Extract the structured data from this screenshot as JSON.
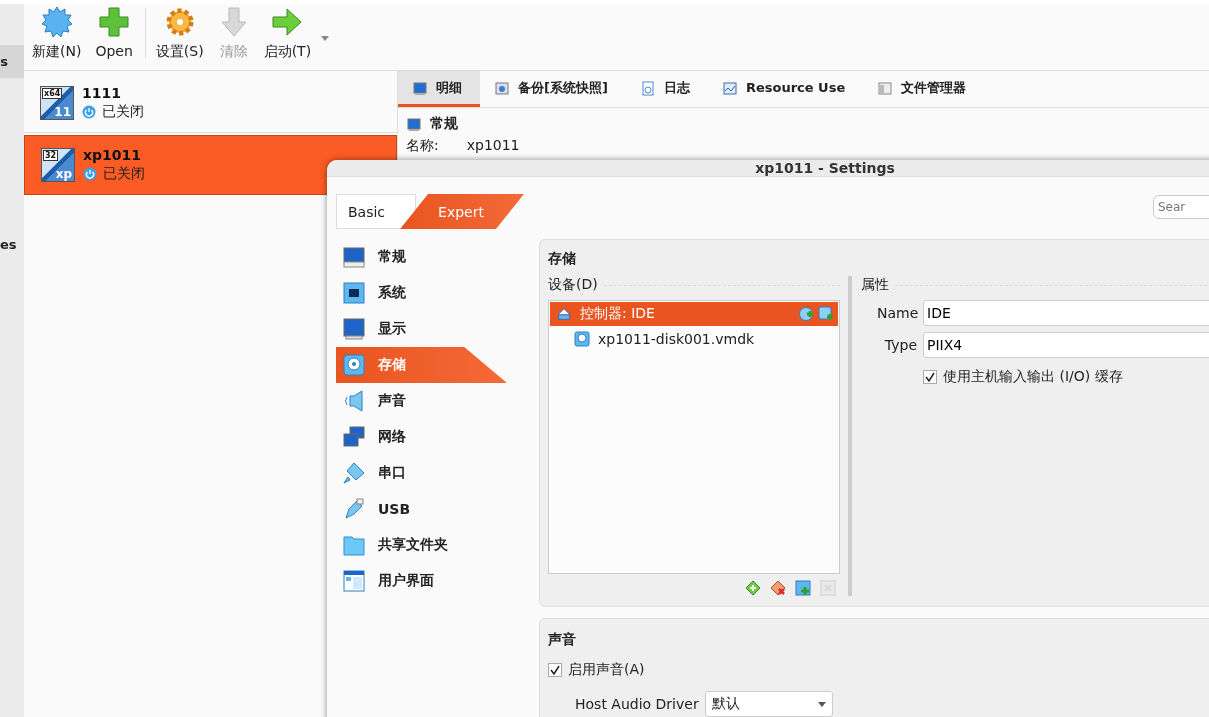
{
  "side_strip": [
    {
      "label": "s",
      "selected": true
    },
    {
      "label": "es",
      "selected": false
    }
  ],
  "toolbar": [
    {
      "label": "新建(N)",
      "kind": "new",
      "disabled": false
    },
    {
      "label": "Open",
      "kind": "add",
      "disabled": false
    },
    {
      "label": "设置(S)",
      "kind": "gear",
      "disabled": false
    },
    {
      "label": "清除",
      "kind": "down",
      "disabled": true
    },
    {
      "label": "启动(T)",
      "kind": "start",
      "disabled": false
    }
  ],
  "vms": [
    {
      "name": "1111",
      "state": "已关闭",
      "os_badge": "x64",
      "os_label": "11",
      "selected": false
    },
    {
      "name": "xp1011",
      "state": "已关闭",
      "os_badge": "32",
      "os_label": "xp",
      "selected": true
    }
  ],
  "details": {
    "tabs": [
      {
        "label": "明细",
        "kind": "details",
        "selected": true
      },
      {
        "label": "备份[系统快照]",
        "kind": "snapshot",
        "selected": false
      },
      {
        "label": "日志",
        "kind": "log",
        "selected": false
      },
      {
        "label": "Resource Use",
        "kind": "resource",
        "selected": false
      },
      {
        "label": "文件管理器",
        "kind": "files",
        "selected": false
      }
    ],
    "section": "常规",
    "rows": [
      {
        "label": "名称:",
        "value": "xp1011"
      }
    ]
  },
  "dialog": {
    "title": "xp1011 - Settings",
    "modes": [
      {
        "label": "Basic",
        "selected": false
      },
      {
        "label": "Expert",
        "selected": true
      }
    ],
    "search": {
      "placeholder": "Sear"
    },
    "nav": [
      {
        "label": "常规",
        "kind": "general",
        "selected": false
      },
      {
        "label": "系统",
        "kind": "system",
        "selected": false
      },
      {
        "label": "显示",
        "kind": "display",
        "selected": false
      },
      {
        "label": "存储",
        "kind": "storage",
        "selected": true
      },
      {
        "label": "声音",
        "kind": "audio",
        "selected": false
      },
      {
        "label": "网络",
        "kind": "network",
        "selected": false
      },
      {
        "label": "串口",
        "kind": "serial",
        "selected": false
      },
      {
        "label": "USB",
        "kind": "usb",
        "selected": false
      },
      {
        "label": "共享文件夹",
        "kind": "folder",
        "selected": false
      },
      {
        "label": "用户界面",
        "kind": "ui",
        "selected": false
      }
    ],
    "storage": {
      "title": "存储",
      "devices_label": "设备(D)",
      "tree": [
        {
          "label": "控制器: IDE",
          "selected": true,
          "children": [
            {
              "label": "xp1011-disk001.vmdk",
              "selected": false
            }
          ]
        }
      ],
      "tools": [
        {
          "kind": "add-controller",
          "disabled": false
        },
        {
          "kind": "remove-controller",
          "disabled": false
        },
        {
          "kind": "add-attachment",
          "disabled": false
        },
        {
          "kind": "remove-attachment",
          "disabled": true
        }
      ],
      "attributes_label": "属性",
      "fields": [
        {
          "label": "Name",
          "value": "IDE"
        },
        {
          "label": "Type",
          "value": "PIIX4"
        }
      ],
      "cache": {
        "label": "使用主机输入输出 (I/O) 缓存",
        "checked": true
      }
    },
    "audio": {
      "title": "声音",
      "enable": {
        "label": "启用声音(A)",
        "checked": true
      },
      "driver_label": "Host Audio Driver",
      "driver_value": "默认"
    }
  }
}
